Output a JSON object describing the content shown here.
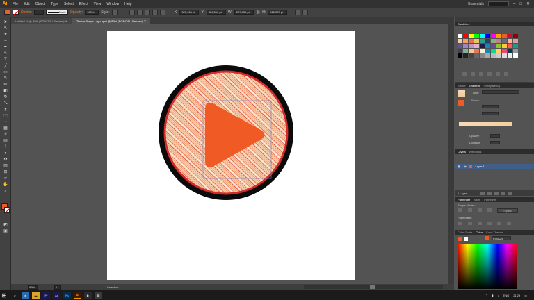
{
  "app": {
    "logo": "Ai",
    "workspace": "Essentials"
  },
  "menu": [
    "File",
    "Edit",
    "Object",
    "Type",
    "Select",
    "Effect",
    "View",
    "Window",
    "Help"
  ],
  "control_bar": {
    "fill_color": "#e8602a",
    "stroke_label": "Stroke:",
    "stroke_profile": "Basic",
    "opacity_label": "Opacity:",
    "opacity_value": "100%",
    "style_label": "Style:",
    "x_label": "X:",
    "x_value": "325,966 pt",
    "y_label": "Y:",
    "y_value": "426,516 pt",
    "w_label": "W:",
    "w_value": "279,750 pt",
    "h_label": "H:",
    "h_value": "222,875 pt"
  },
  "tabs": [
    {
      "label": "Untitled-1* @ 89% (RGB/GPU Preview)",
      "active": false
    },
    {
      "label": "Timber Player Logo.eps* @ 89% (RGB/GPU Preview)",
      "active": true
    }
  ],
  "status": {
    "zoom": "89%",
    "page": "1",
    "mode": "Selection"
  },
  "panels": {
    "swatches_title": "Swatches",
    "gradient_tabs": [
      "Stroke",
      "Gradient",
      "Transparency"
    ],
    "gradient_type_label": "Type:",
    "gradient_stroke_label": "Stroke:",
    "gradient_opacity_label": "Opacity:",
    "gradient_location_label": "Location:",
    "layers_tabs": [
      "Layers",
      "Artboards"
    ],
    "layer_name": "Layer 1",
    "layers_count": "1 Layer",
    "pathfinder_tabs": [
      "Pathfinder",
      "Align",
      "Transform"
    ],
    "shape_modes": "Shape Modes:",
    "pathfinders": "Pathfinders:",
    "expand": "Expand",
    "color_tabs": [
      "Color Guide",
      "Color",
      "Color Themes"
    ],
    "hex_value": "F55A24"
  },
  "taskbar": {
    "lang": "ENG",
    "time": "21:29"
  },
  "colors": {
    "accent": "#ff9a00",
    "play": "#f05a24",
    "circle_inner": "#f5c7a0",
    "hatch": "#d23a2a"
  }
}
